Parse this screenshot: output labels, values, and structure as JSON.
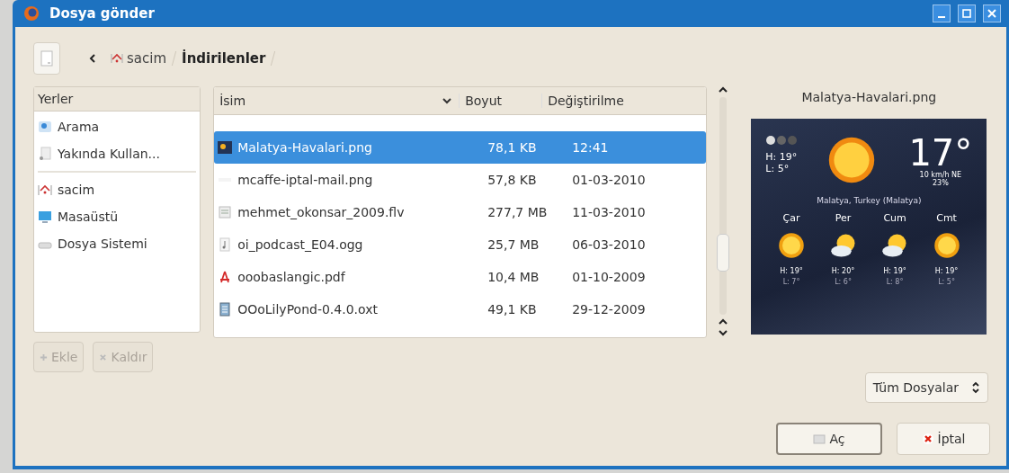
{
  "window": {
    "title": "Dosya gönder"
  },
  "path_bar": {
    "segments": [
      {
        "label": "sacim",
        "kind": "home",
        "selected": false
      },
      {
        "label": "İndirilenler",
        "kind": "folder",
        "selected": true
      }
    ]
  },
  "places": {
    "header": "Yerler",
    "groups": [
      [
        {
          "label": "Arama",
          "kind": "search"
        },
        {
          "label": "Yakında Kullan...",
          "kind": "recent"
        }
      ],
      [
        {
          "label": "sacim",
          "kind": "home"
        },
        {
          "label": "Masaüstü",
          "kind": "desktop"
        },
        {
          "label": "Dosya Sistemi",
          "kind": "drive"
        }
      ]
    ]
  },
  "place_buttons": [
    {
      "label": "Ekle",
      "kind": "add",
      "disabled": true
    },
    {
      "label": "Kaldır",
      "kind": "remove",
      "disabled": true
    }
  ],
  "files": {
    "columns": [
      "İsim",
      "Boyut",
      "Değiştirilme"
    ],
    "rows": [
      {
        "name": "Malatya-Havalari.png",
        "size": "78,1 KB",
        "modified": "12:41",
        "kind": "thumb",
        "selected": true
      },
      {
        "name": "mcaffe-iptal-mail.png",
        "size": "57,8 KB",
        "modified": "01-03-2010",
        "kind": "blank",
        "selected": false
      },
      {
        "name": "mehmet_okonsar_2009.flv",
        "size": "277,7 MB",
        "modified": "11-03-2010",
        "kind": "video",
        "selected": false
      },
      {
        "name": "oi_podcast_E04.ogg",
        "size": "25,7 MB",
        "modified": "06-03-2010",
        "kind": "audio",
        "selected": false
      },
      {
        "name": "ooobaslangic.pdf",
        "size": "10,4 MB",
        "modified": "01-10-2009",
        "kind": "pdf",
        "selected": false
      },
      {
        "name": "OOoLilyPond-0.4.0.oxt",
        "size": "49,1 KB",
        "modified": "29-12-2009",
        "kind": "package",
        "selected": false
      }
    ]
  },
  "preview": {
    "filename": "Malatya-Havalari.png",
    "widget": {
      "temperature": "17°",
      "high": "H: 19°",
      "low": "L: 5°",
      "wind": "10 km/h NE",
      "humidity": "23%",
      "location": "Malatya, Turkey (Malatya)",
      "days": [
        {
          "day": "Çar",
          "high": "H: 19°",
          "low": "L: 7°",
          "kind": "sun"
        },
        {
          "day": "Per",
          "high": "H: 20°",
          "low": "L: 6°",
          "kind": "cloud"
        },
        {
          "day": "Cum",
          "high": "H: 19°",
          "low": "L: 8°",
          "kind": "cloud"
        },
        {
          "day": "Cmt",
          "high": "H: 19°",
          "low": "L: 5°",
          "kind": "sun"
        }
      ]
    }
  },
  "filter": {
    "value": "Tüm Dosyalar"
  },
  "buttons": [
    {
      "label": "Aç",
      "kind": "open"
    },
    {
      "label": "İptal",
      "kind": "cancel"
    }
  ]
}
